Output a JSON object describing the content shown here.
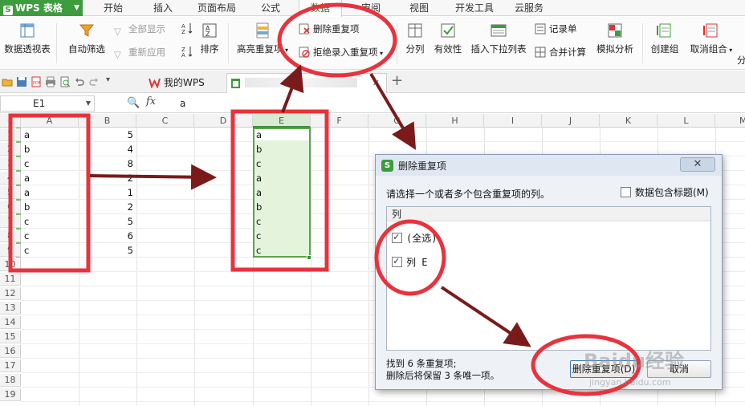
{
  "app": {
    "logo": "S",
    "name": "WPS 表格"
  },
  "menu_tabs": [
    "开始",
    "插入",
    "页面布局",
    "公式",
    "数据",
    "审阅",
    "视图",
    "开发工具",
    "云服务"
  ],
  "ribbon": {
    "pivot": "数据透视表",
    "autofilter": "自动筛选",
    "show_all": "全部显示",
    "reapply": "重新应用",
    "sort": "排序",
    "highlight_dup": "高亮重复项",
    "remove_dup": "删除重复项",
    "reject_dup": "拒绝录入重复项",
    "split": "分列",
    "validity": "有效性",
    "insert_dropdown": "插入下拉列表",
    "record": "记录单",
    "merge_calc": "合并计算",
    "simulate": "模拟分析",
    "create_group": "创建组",
    "ungroup": "取消组合",
    "overflow": "分"
  },
  "doc_tabs": {
    "mywps": "我的WPS",
    "active_doc": ""
  },
  "formula_bar": {
    "name_box": "E1",
    "fx": "fx",
    "value": "a"
  },
  "columns": [
    "A",
    "B",
    "C",
    "D",
    "E",
    "F",
    "G",
    "H",
    "I",
    "J",
    "K",
    "L",
    "M"
  ],
  "rows": [
    "1",
    "2",
    "3",
    "4",
    "5",
    "6",
    "7",
    "8",
    "9",
    "10",
    "11",
    "12",
    "13",
    "14",
    "15",
    "16",
    "17",
    "18",
    "19"
  ],
  "col_a": [
    "a",
    "b",
    "c",
    "a",
    "a",
    "b",
    "c",
    "c",
    "c"
  ],
  "col_b": [
    "5",
    "4",
    "8",
    "2",
    "1",
    "2",
    "5",
    "6",
    "5"
  ],
  "col_e": [
    "a",
    "b",
    "c",
    "a",
    "a",
    "b",
    "c",
    "c",
    "c"
  ],
  "dialog": {
    "logo": "S",
    "title": "删除重复项",
    "close": "✕",
    "prompt": "请选择一个或者多个包含重复项的列。",
    "header_checkbox": "数据包含标题(M)",
    "list_header": "列",
    "items": [
      "(全选)",
      "列 E"
    ],
    "result_line1": "找到 6 条重复项;",
    "result_line2": "删除后将保留 3 条唯一项。",
    "ok": "删除重复项(D)",
    "cancel": "取消"
  },
  "watermark": "Baidu经验",
  "watermark_sub": "jingyan.baidu.com",
  "colors": {
    "brand_green": "#3d9c3d",
    "annotation_red": "#e8323c",
    "arrow": "#7a1a1a",
    "selection_fill": "#e4f3dc"
  }
}
